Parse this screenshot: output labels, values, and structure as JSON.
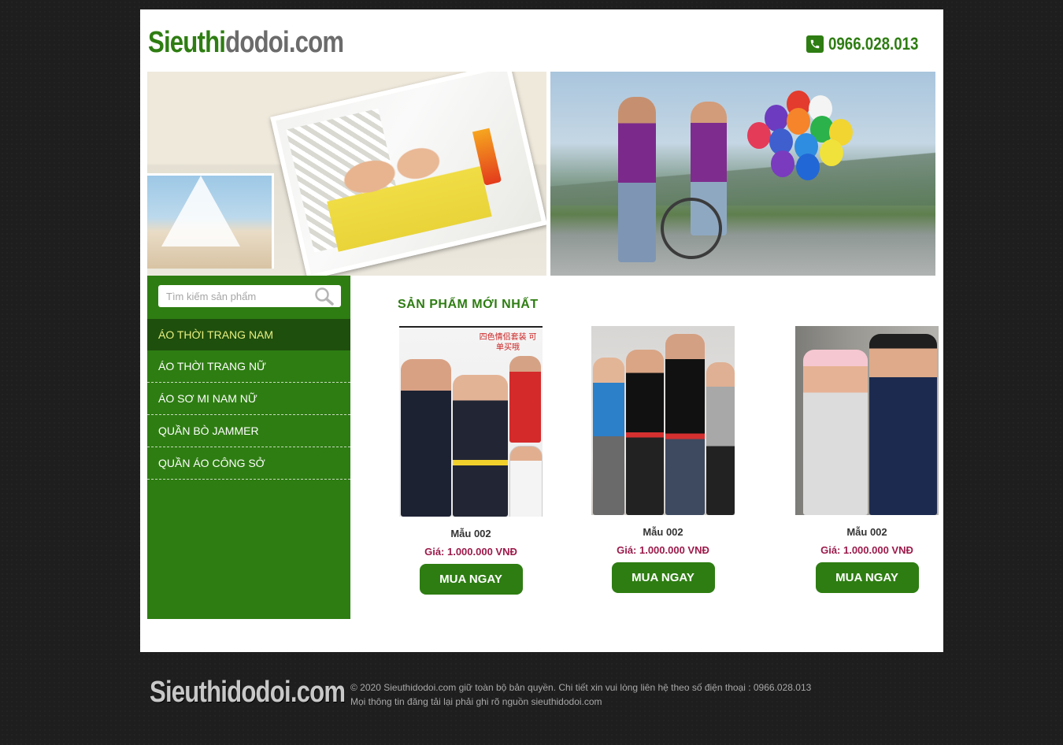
{
  "header": {
    "logo_part1": "Sieuthi",
    "logo_part2": "dodoi.com",
    "phone": "0966.028.013",
    "phone_icon": "phone-icon"
  },
  "search": {
    "placeholder": "Tìm kiếm sản phẩm",
    "icon": "search-icon"
  },
  "menu": {
    "items": [
      {
        "label": "ÁO THỜI TRANG NAM",
        "active": true
      },
      {
        "label": "ÁO THỜI TRANG NỮ",
        "active": false
      },
      {
        "label": "ÁO SƠ MI NAM NỮ",
        "active": false
      },
      {
        "label": "QUẦN BÒ JAMMER",
        "active": false
      },
      {
        "label": "QUẦN ÁO CÔNG SỞ",
        "active": false
      }
    ]
  },
  "products": {
    "section_title": "SẢN PHẨM MỚI NHẤT",
    "items": [
      {
        "name": "Mẫu 002",
        "price": "Giá: 1.000.000 VNĐ",
        "button": "MUA NGAY",
        "image_caption": "四色情侣套装 可单买哦"
      },
      {
        "name": "Mẫu 002",
        "price": "Giá: 1.000.000 VNĐ",
        "button": "MUA NGAY"
      },
      {
        "name": "Mẫu 002",
        "price": "Giá: 1.000.000 VNĐ",
        "button": "MUA NGAY"
      }
    ]
  },
  "footer": {
    "logo": "Sieuthidodoi.com",
    "line1": "© 2020 Sieuthidodoi.com giữ toàn bộ bản quyền. Chi tiết xin vui lòng liên hệ theo số điện thoại : 0966.028.013",
    "line2": "Mọi thông tin đăng tải lại phải ghi rõ nguồn sieuthidodoi.com"
  },
  "colors": {
    "brand_green": "#2e7d12",
    "menu_active_bg": "#1f4f0d",
    "price": "#9c1a4a",
    "page_bg": "#1e1e1e"
  }
}
